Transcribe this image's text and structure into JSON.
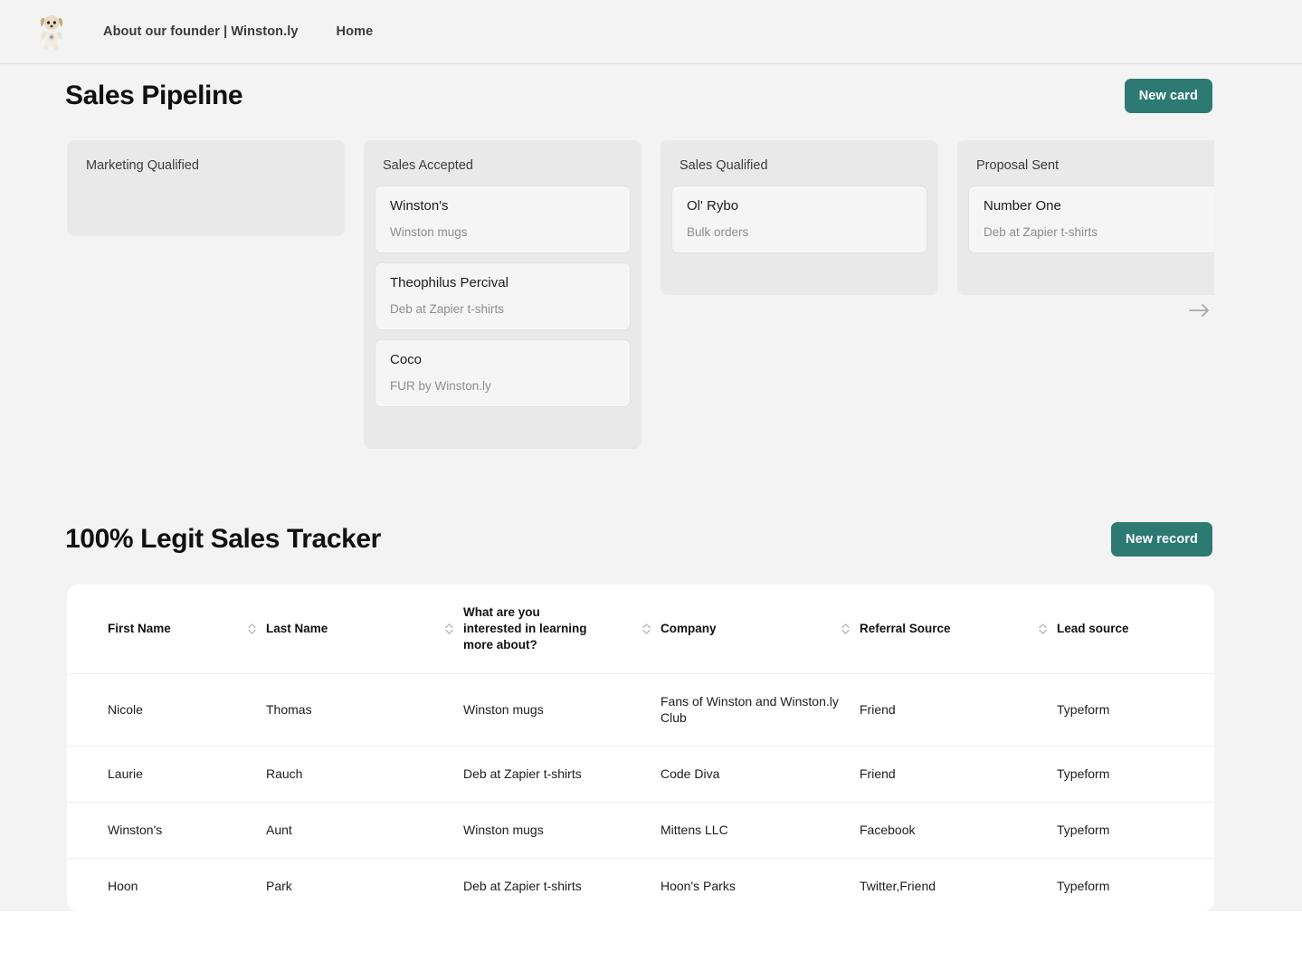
{
  "nav": {
    "logo_icon": "dog-avatar-logo",
    "links": [
      {
        "label": "About our founder | Winston.ly"
      },
      {
        "label": "Home"
      }
    ]
  },
  "pipeline_section": {
    "title": "Sales Pipeline",
    "new_card_label": "New card",
    "scroll_right_icon": "arrow-right-icon",
    "accent_color": "#2c7a72",
    "columns": [
      {
        "title": "Marketing Qualified",
        "cards": []
      },
      {
        "title": "Sales Accepted",
        "cards": [
          {
            "title": "Winston's",
            "subtitle": "Winston mugs"
          },
          {
            "title": "Theophilus Percival",
            "subtitle": "Deb at Zapier t-shirts"
          },
          {
            "title": "Coco",
            "subtitle": "FUR by Winston.ly"
          }
        ]
      },
      {
        "title": "Sales Qualified",
        "cards": [
          {
            "title": "Ol' Rybo",
            "subtitle": "Bulk orders"
          }
        ]
      },
      {
        "title": "Proposal Sent",
        "cards": [
          {
            "title": "Number One",
            "subtitle": "Deb at Zapier t-shirts"
          }
        ]
      }
    ]
  },
  "tracker_section": {
    "title": "100% Legit Sales Tracker",
    "new_record_label": "New record",
    "columns": [
      {
        "label": "First Name",
        "sort_icon": "sort-chevrons-icon"
      },
      {
        "label": "Last Name",
        "sort_icon": "sort-chevrons-icon"
      },
      {
        "label": "What are you interested in learning more about?",
        "sort_icon": "sort-chevrons-icon"
      },
      {
        "label": "Company",
        "sort_icon": "sort-chevrons-icon"
      },
      {
        "label": "Referral Source",
        "sort_icon": "sort-chevrons-icon"
      },
      {
        "label": "Lead source",
        "sort_icon": null
      }
    ],
    "rows": [
      {
        "first_name": "Nicole",
        "last_name": "Thomas",
        "interest": "Winston mugs",
        "company": "Fans of Winston and Winston.ly Club",
        "referral_source": "Friend",
        "lead_source": "Typeform"
      },
      {
        "first_name": "Laurie",
        "last_name": "Rauch",
        "interest": "Deb at Zapier t-shirts",
        "company": "Code Diva",
        "referral_source": "Friend",
        "lead_source": "Typeform"
      },
      {
        "first_name": "Winston's",
        "last_name": "Aunt",
        "interest": "Winston mugs",
        "company": "Mittens LLC",
        "referral_source": "Facebook",
        "lead_source": "Typeform"
      },
      {
        "first_name": "Hoon",
        "last_name": "Park",
        "interest": "Deb at Zapier t-shirts",
        "company": "Hoon's Parks",
        "referral_source": "Twitter,Friend",
        "lead_source": "Typeform"
      }
    ]
  }
}
